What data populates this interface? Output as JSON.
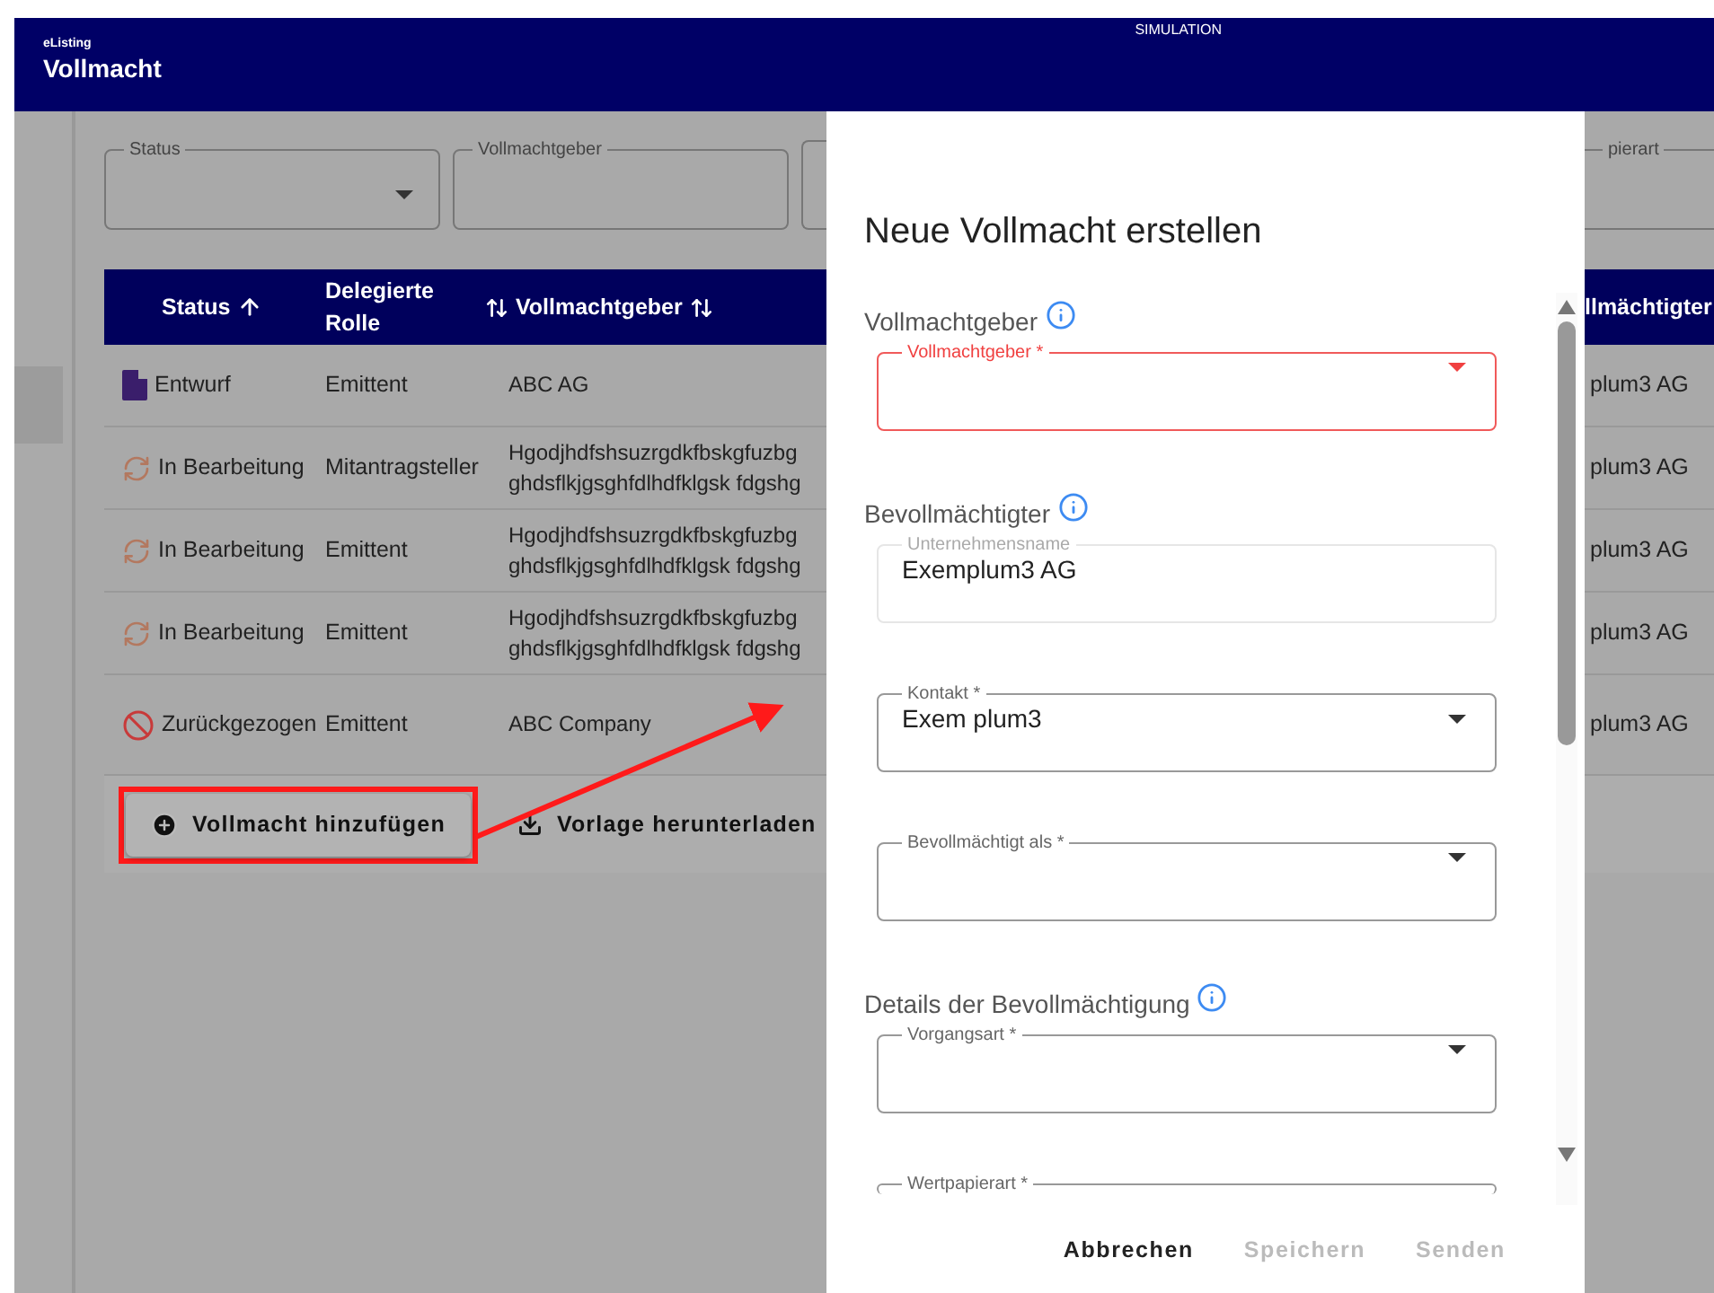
{
  "header": {
    "app_name": "eListing",
    "title": "Vollmacht",
    "mode": "SIMULATION"
  },
  "filters": [
    {
      "label": "Status",
      "kind": "select"
    },
    {
      "label": "Vollmachtgeber",
      "kind": "text"
    }
  ],
  "filter_right": {
    "label": "pierart"
  },
  "table": {
    "columns": [
      {
        "label": "Status",
        "sorted": true
      },
      {
        "label": "Delegierte Rolle",
        "sorted": false
      },
      {
        "label": "Vollmachtgeber",
        "sorted": false
      }
    ],
    "column_right": "llmächtigter",
    "rows": [
      {
        "status": {
          "kind": "draft",
          "label": "Entwurf"
        },
        "role": "Emittent",
        "giver": [
          "ABC AG"
        ],
        "column_right": "plum3 AG"
      },
      {
        "status": {
          "kind": "in_progress",
          "label": "In Bearbeitung"
        },
        "role": "Mitantragsteller",
        "giver": [
          "Hgodjhdfshsuzrgdkfbskgfuzbg",
          "ghdsflkjgsghfdlhdfklgsk fdgshg"
        ],
        "column_right": "plum3 AG"
      },
      {
        "status": {
          "kind": "in_progress",
          "label": "In Bearbeitung"
        },
        "role": "Emittent",
        "giver": [
          "Hgodjhdfshsuzrgdkfbskgfuzbg",
          "ghdsflkjgsghfdlhdfklgsk fdgshg"
        ],
        "column_right": "plum3 AG"
      },
      {
        "status": {
          "kind": "in_progress",
          "label": "In Bearbeitung"
        },
        "role": "Emittent",
        "giver": [
          "Hgodjhdfshsuzrgdkfbskgfuzbg",
          "ghdsflkjgsghfdlhdfklgsk fdgshg"
        ],
        "column_right": "plum3 AG"
      },
      {
        "status": {
          "kind": "withdrawn",
          "label": "Zurückgezogen"
        },
        "role": "Emittent",
        "giver": [
          "ABC Company"
        ],
        "column_right": "plum3 AG"
      }
    ]
  },
  "actions": [
    {
      "label": "Vollmacht hinzufügen",
      "kind": "add",
      "highlighted": true
    },
    {
      "label": "Vorlage herunterladen",
      "kind": "download",
      "highlighted": false
    }
  ],
  "dialog": {
    "title": "Neue Vollmacht erstellen",
    "sections": [
      {
        "title": "Vollmachtgeber",
        "fields": [
          {
            "label": "Vollmachtgeber *",
            "kind": "select",
            "error": true
          }
        ]
      },
      {
        "title": "Bevollmächtigter",
        "fields": [
          {
            "label": "Unternehmensname",
            "kind": "text",
            "value": "Exemplum3 AG",
            "error": false
          },
          {
            "label": "Kontakt *",
            "kind": "select",
            "value": "Exem plum3",
            "error": false
          },
          {
            "label": "Bevollmächtigt als *",
            "kind": "select",
            "error": false
          }
        ]
      },
      {
        "title": "Details der Bevollmächtigung",
        "fields": [
          {
            "label": "Vorgangsart *",
            "kind": "select",
            "error": false
          },
          {
            "label": "Wertpapierart *",
            "kind": "select",
            "error": false
          }
        ]
      }
    ],
    "buttons": [
      {
        "label": "Abbrechen",
        "disabled": false
      },
      {
        "label": "Speichern",
        "disabled": true
      },
      {
        "label": "Senden",
        "disabled": true
      }
    ]
  }
}
